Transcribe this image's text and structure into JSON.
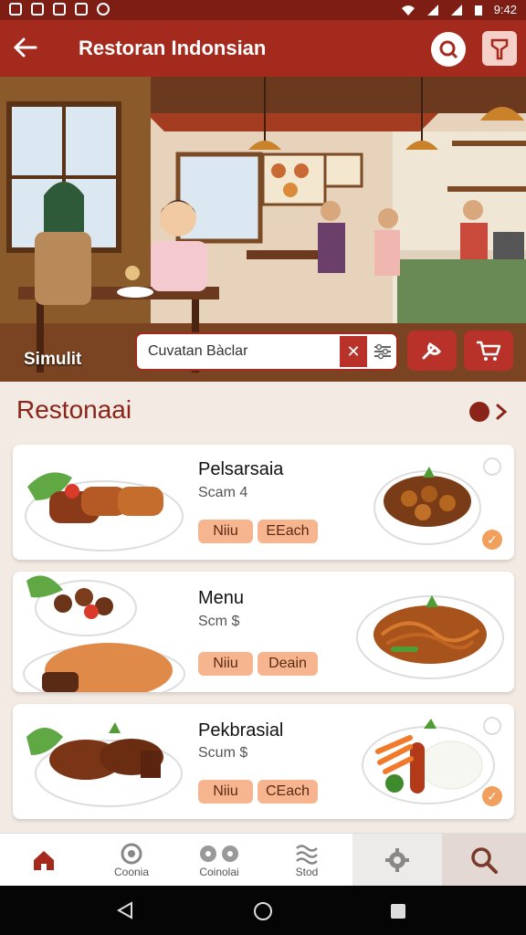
{
  "status_bar": {
    "time": "9:42"
  },
  "app_bar": {
    "title": "Restoran Indonsian"
  },
  "hero": {
    "label": "Simulit"
  },
  "search": {
    "value": "Cuvatan Bàclar"
  },
  "section": {
    "title": "Restonaai"
  },
  "menu_items": [
    {
      "name": "Pelsarsaia",
      "sub": "Scam 4",
      "tag1": "Niiu",
      "tag2": "EEach"
    },
    {
      "name": "Menu",
      "sub": "Scm $",
      "tag1": "Niiu",
      "tag2": "Deain"
    },
    {
      "name": "Pekbrasial",
      "sub": "Scum $",
      "tag1": "Niiu",
      "tag2": "CEach"
    }
  ],
  "bottom_nav": [
    {
      "label": "",
      "icon": "home-icon"
    },
    {
      "label": "Coonia",
      "icon": "ring-icon"
    },
    {
      "label": "Coinolai",
      "icon": "flower-icon"
    },
    {
      "label": "Stod",
      "icon": "wave-icon"
    },
    {
      "label": "",
      "icon": "gear-icon"
    },
    {
      "label": "",
      "icon": "search-icon"
    }
  ],
  "colors": {
    "primary": "#a52a1e",
    "dark": "#7e1d14",
    "accent": "#f6b58e",
    "background": "#f3ebe3"
  }
}
